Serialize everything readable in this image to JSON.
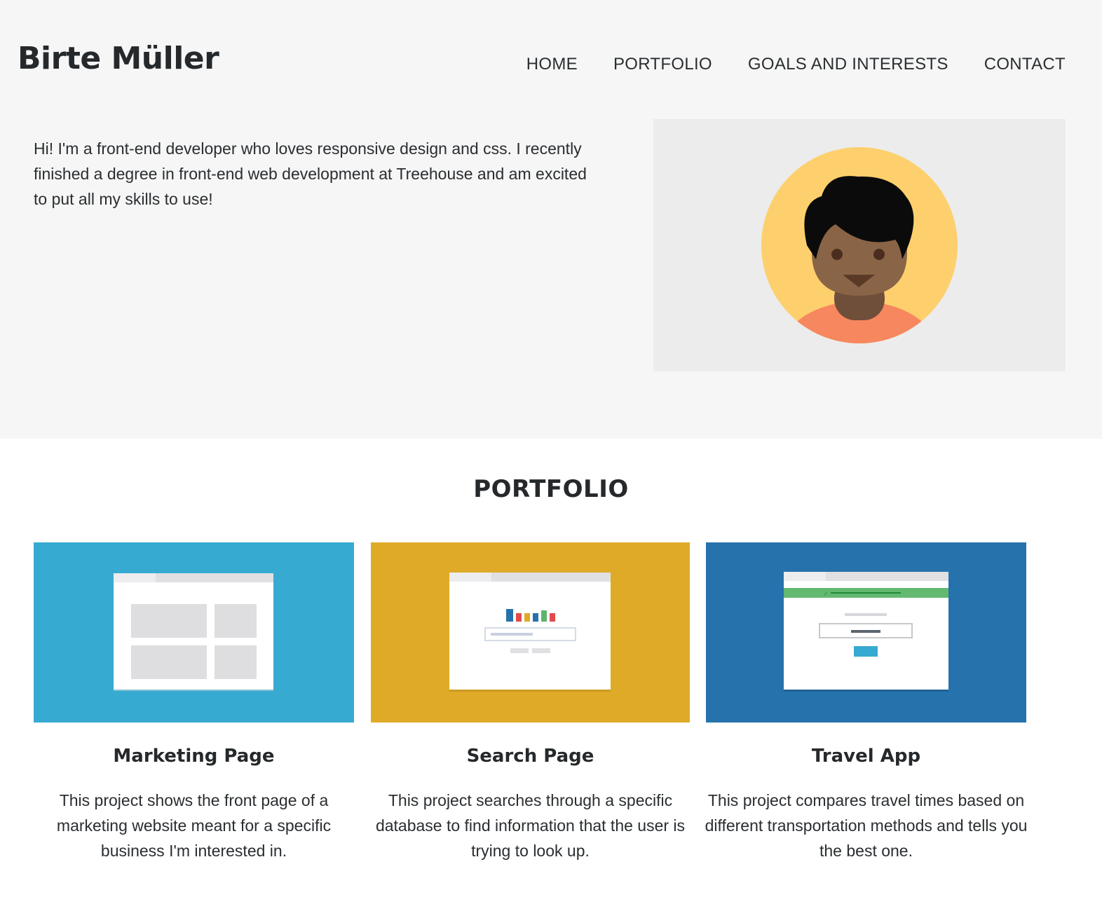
{
  "header": {
    "brand": "Birte Müller",
    "nav": [
      {
        "label": "HOME"
      },
      {
        "label": "PORTFOLIO"
      },
      {
        "label": "GOALS AND INTERESTS"
      },
      {
        "label": "CONTACT"
      }
    ]
  },
  "hero": {
    "intro": "Hi! I'm a front-end developer who loves responsive design and css. I recently finished a degree in front-end web development at Treehouse and am excited to put all my skills to use!",
    "avatar_icon": "person-avatar-icon"
  },
  "portfolio": {
    "title": "PORTFOLIO",
    "projects": [
      {
        "title": "Marketing Page",
        "description": "This project shows the front page of a marketing website meant for a specific business I'm interested in.",
        "icon": "marketing-page-thumbnail",
        "color": "#37aad1"
      },
      {
        "title": "Search Page",
        "description": "This project searches through a specific database to find information that the user is trying to look up.",
        "icon": "search-page-thumbnail",
        "color": "#dfaa28"
      },
      {
        "title": "Travel App",
        "description": "This project compares travel times based on different transportation methods and tells you the best one.",
        "icon": "travel-app-thumbnail",
        "color": "#2672ac"
      }
    ]
  },
  "colors": {
    "hero_bg": "#f6f6f6",
    "avatar_bg": "#ececec",
    "avatar_circle": "#fdd06d",
    "shirt": "#f7875f",
    "text": "#25292c"
  }
}
